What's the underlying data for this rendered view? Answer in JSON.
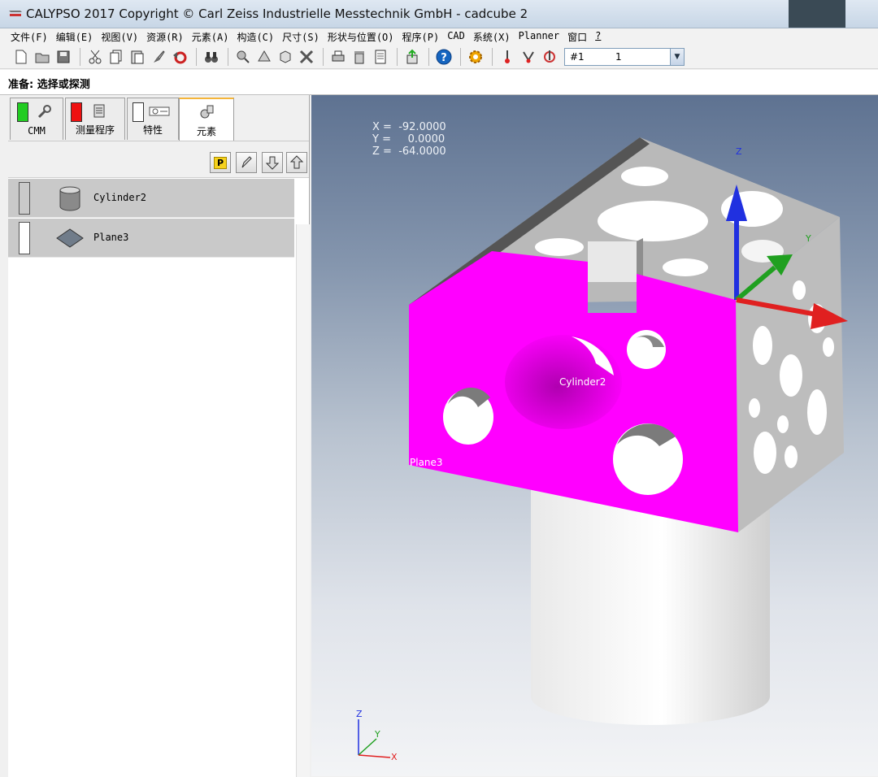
{
  "window": {
    "title": "CALYPSO 2017 Copyright © Carl Zeiss Industrielle Messtechnik GmbH - cadcube 2"
  },
  "menu": [
    "文件(F)",
    "编辑(E)",
    "视图(V)",
    "资源(R)",
    "元素(A)",
    "构造(C)",
    "尺寸(S)",
    "形状与位置(O)",
    "程序(P)",
    "CAD",
    "系统(X)",
    "Planner",
    "窗口",
    "?"
  ],
  "toolbar": {
    "select_left": "#1",
    "select_right": "1"
  },
  "status": {
    "text": "准备: 选择或探测"
  },
  "tabs": [
    {
      "label": "CMM",
      "indicator": "#22cc22"
    },
    {
      "label": "测量程序",
      "indicator": "#ee1111"
    },
    {
      "label": "特性",
      "indicator": "#ffffff"
    },
    {
      "label": "元素",
      "indicator": ""
    }
  ],
  "list": {
    "p_button": "P",
    "items": [
      {
        "label": "Cylinder2",
        "icon": "cylinder-icon"
      },
      {
        "label": "Plane3",
        "icon": "plane-icon"
      }
    ]
  },
  "viewport": {
    "coords": {
      "x_label": "X =",
      "x_value": "-92.0000",
      "y_label": "Y =",
      "y_value": "0.0000",
      "z_label": "Z =",
      "z_value": "-64.0000"
    },
    "labels": {
      "cylinder": "Cylinder2",
      "plane": "Plane3"
    },
    "axes": {
      "x": "X",
      "y": "Y",
      "z": "Z"
    },
    "colors": {
      "selected_face": "#ff00ff",
      "x_axis": "#e02020",
      "y_axis": "#20a020",
      "z_axis": "#2030e0"
    }
  }
}
